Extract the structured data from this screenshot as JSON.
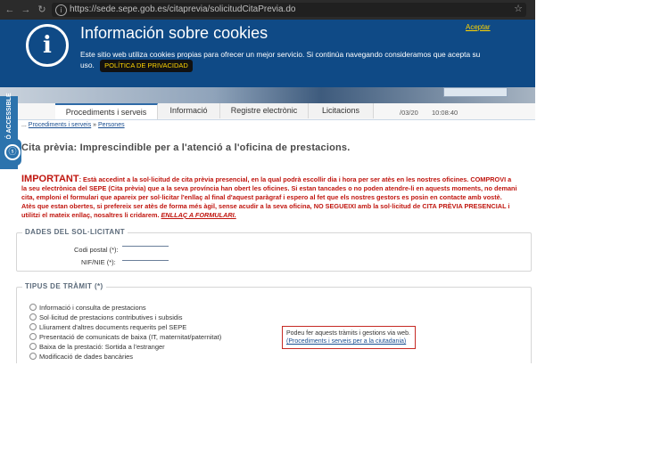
{
  "browser": {
    "url": "https://sede.sepe.gob.es/citaprevia/solicitudCitaPrevia.do",
    "back_icon": "arrow-left",
    "forward_icon": "arrow-right",
    "reload_icon": "reload",
    "info_icon": "i",
    "star_icon": "☆"
  },
  "cookie_banner": {
    "icon": "i",
    "title": "Información sobre cookies",
    "accept": "Aceptar",
    "text": "Este sitio web utiliza cookies propias para ofrecer un mejor servicio. Si continúa navegando consideramos que acepta su uso.",
    "policy": "POLÍTICA DE PRIVACIDAD"
  },
  "accessibility": {
    "label": "VERSIÓ ACCESSIBLE",
    "icon": "ⓢ"
  },
  "tabs": [
    {
      "label": "Procediments i serveis"
    },
    {
      "label": "Informació"
    },
    {
      "label": "Registre electrònic"
    },
    {
      "label": "Licitacions"
    }
  ],
  "header_info": {
    "date": "/03/20",
    "time": "10:08:40"
  },
  "breadcrumb": {
    "prefix": "...",
    "link1": "Procediments i serveis",
    "sep": " » ",
    "link2": "Persones"
  },
  "page_title": "Cita prèvia: Imprescindible per a l'atenció a l'oficina de prestacions.",
  "important": {
    "title": "IMPORTANT",
    "text": ": Està accedint a la sol·licitud de cita prèvia presencial, en la qual podrà escollir dia i hora per ser atès en les nostres oficines. COMPROVI a la seu electrònica del SEPE (Cita prèvia) que a la seva província han obert les oficines. Si estan tancades o no poden atendre-li en aquests moments, no demani cita, emploni el formulari que apareix per sol·licitar l'enllaç al final d'aquest paràgraf i espero al fet que els nostres gestors es posin en contacte amb vostè. Atès que estan obertes, si prefereix ser atès de forma més àgil, sense acudir a la seva oficina, NO SEGUEIXI amb la sol·licitud de CITA PRÈVIA PRESENCIAL i utilitzi el mateix enllaç, nosaltres li cridarem.",
    "link": "ENLLAÇ A FORMULARI."
  },
  "applicant": {
    "legend": "DADES DEL SOL·LICITANT",
    "postal_label": "Codi postal (*):",
    "nif_label": "NIF/NIE (*):"
  },
  "procedure": {
    "legend": "TIPUS DE TRÀMIT (*)",
    "options": [
      "Informació i consulta de prestacions",
      "Sol·licitud de prestacions contributives i subsidis",
      "Lliurament d'altres documents requerits pel SEPE",
      "Presentació de comunicats de baixa (IT, maternitat/paternitat)",
      "Baixa de la prestació: Sortida a l'estranger",
      "Modificació de dades bancàries"
    ]
  },
  "note": {
    "text": "Podeu fer aquests tràmits i gestions via web.",
    "link": "(Procediments i serveis per a la ciutadania)"
  }
}
